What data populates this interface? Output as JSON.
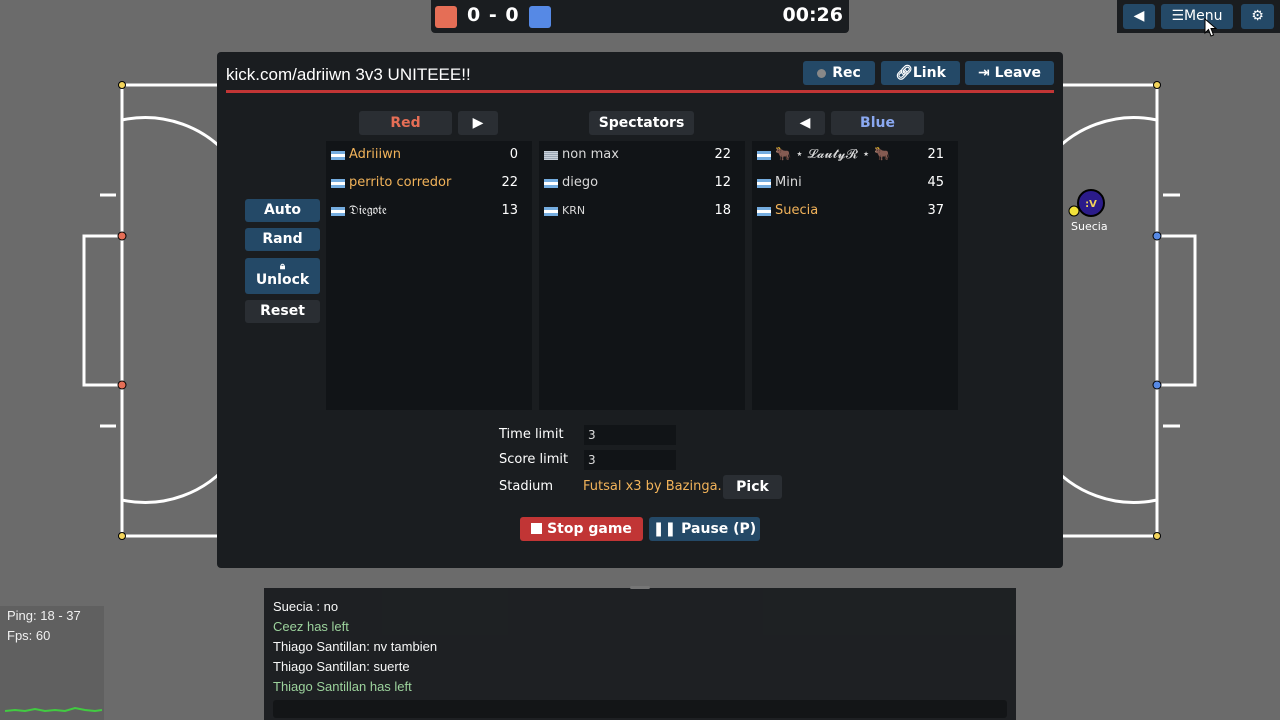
{
  "scorebar": {
    "score": "0 - 0",
    "time": "00:26",
    "red_color": "#e56e56",
    "blue_color": "#5689e5"
  },
  "topright": {
    "menu_label": "Menu"
  },
  "dialog": {
    "room_title": "kick.com/adriiwn 3v3 UNITEEE!!",
    "rec_label": "Rec",
    "link_label": "Link",
    "leave_label": "Leave",
    "red_label": "Red",
    "spectators_label": "Spectators",
    "blue_label": "Blue",
    "side_buttons": {
      "auto": "Auto",
      "rand": "Rand",
      "unlock": "Unlock",
      "reset": "Reset"
    },
    "red_players": [
      {
        "name": "Adriiiwn",
        "ping": "0"
      },
      {
        "name": "perrito corredor",
        "ping": "22"
      },
      {
        "name": "𝔇𝔦𝔢𝔤𝔬𝔱𝔢",
        "ping": "13"
      }
    ],
    "spectators": [
      {
        "name": "non max",
        "ping": "22"
      },
      {
        "name": "diego",
        "ping": "12"
      },
      {
        "name": "KRN",
        "ping": "18"
      }
    ],
    "blue_players": [
      {
        "name": "🐂 ⋆ 𝓛𝓪𝓾𝓽𝔂𝓡 ⋆ 🐂",
        "ping": "21"
      },
      {
        "name": "Mini",
        "ping": "45"
      },
      {
        "name": "Suecia",
        "ping": "37"
      }
    ],
    "settings": {
      "time_limit_label": "Time limit",
      "time_limit": "3",
      "score_limit_label": "Score limit",
      "score_limit": "3",
      "stadium_label": "Stadium",
      "stadium": "Futsal x3 by Bazinga...",
      "pick_label": "Pick"
    },
    "stop_label": "Stop game",
    "pause_label": "Pause (P)"
  },
  "chat": {
    "lines": [
      {
        "text": "Suecia : no",
        "kind": "normal"
      },
      {
        "text": "Ceez has left",
        "kind": "notice"
      },
      {
        "text": "Thiago Santillan: nv tambien",
        "kind": "normal"
      },
      {
        "text": "Thiago Santillan: suerte",
        "kind": "normal"
      },
      {
        "text": "Thiago Santillan has left",
        "kind": "notice"
      }
    ]
  },
  "stats": {
    "ping": "Ping: 18 - 37",
    "fps": "Fps: 60"
  },
  "field": {
    "player_label": "Suecia",
    "player_avatar": ":V"
  }
}
